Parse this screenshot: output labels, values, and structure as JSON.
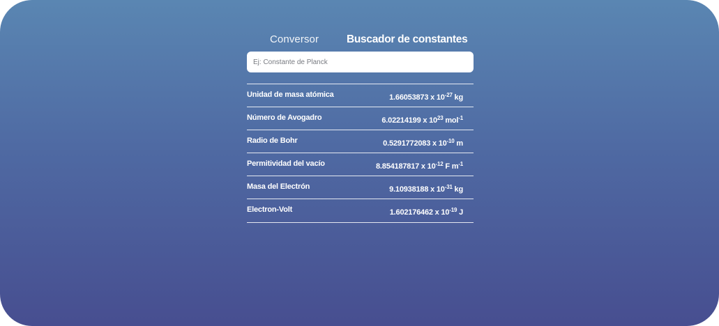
{
  "tabs": {
    "conversor": "Conversor",
    "buscador": "Buscador de constantes"
  },
  "search": {
    "placeholder": "Ej: Constante de Planck"
  },
  "constants": [
    {
      "name": "Unidad de masa atómica",
      "mantissa": "1.66053873 x 10",
      "exponent": "-27",
      "unit": " kg",
      "unit_exponent": ""
    },
    {
      "name": "Número de Avogadro",
      "mantissa": "6.02214199 x 10",
      "exponent": "23",
      "unit": " mol",
      "unit_exponent": "-1"
    },
    {
      "name": "Radio de Bohr",
      "mantissa": "0.5291772083 x 10",
      "exponent": "-10",
      "unit": " m",
      "unit_exponent": ""
    },
    {
      "name": "Permitividad del vacío",
      "mantissa": "8.854187817 x 10",
      "exponent": "-12",
      "unit": " F m",
      "unit_exponent": "-1"
    },
    {
      "name": "Masa del Electrón",
      "mantissa": "9.10938188 x 10",
      "exponent": "-31",
      "unit": " kg",
      "unit_exponent": ""
    },
    {
      "name": "Electron-Volt",
      "mantissa": "1.602176462 x 10",
      "exponent": "-19",
      "unit": " J",
      "unit_exponent": ""
    }
  ],
  "colors": {
    "gradient_top": "#5a86b2",
    "gradient_bottom": "#474e90",
    "text": "#ffffff"
  }
}
